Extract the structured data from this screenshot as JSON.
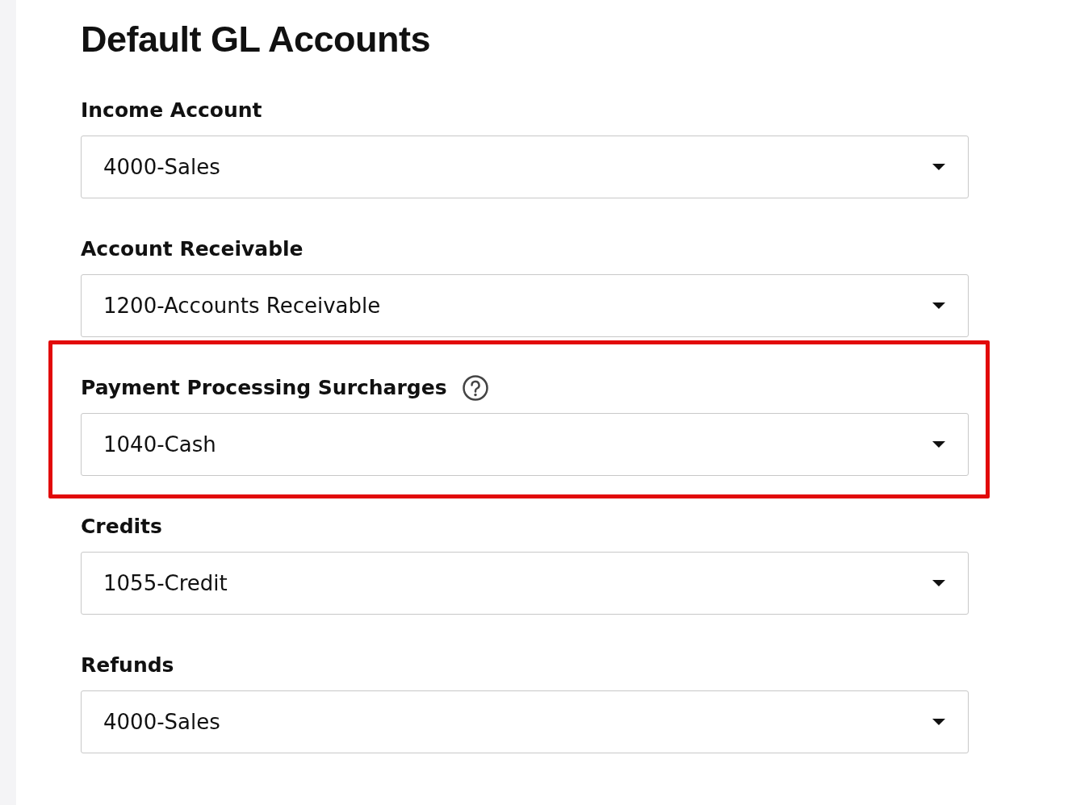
{
  "title": "Default GL Accounts",
  "fields": [
    {
      "label": "Income Account",
      "value": "4000-Sales",
      "help": false,
      "highlighted": false
    },
    {
      "label": "Account Receivable",
      "value": "1200-Accounts Receivable",
      "help": false,
      "highlighted": false
    },
    {
      "label": "Payment Processing Surcharges",
      "value": "1040-Cash",
      "help": true,
      "highlighted": true
    },
    {
      "label": "Credits",
      "value": "1055-Credit",
      "help": false,
      "highlighted": false
    },
    {
      "label": "Refunds",
      "value": "4000-Sales",
      "help": false,
      "highlighted": false
    }
  ]
}
